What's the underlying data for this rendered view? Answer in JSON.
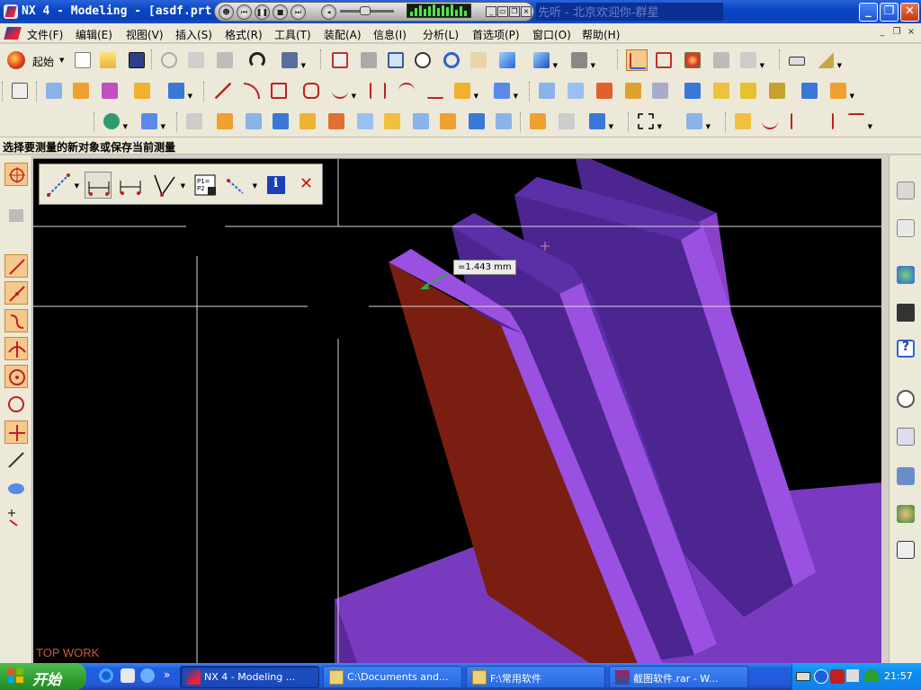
{
  "window": {
    "title": "NX 4 - Modeling - [asdf.prt",
    "lyric": "先听 - 北京欢迎你-群星",
    "buttons": {
      "minimize": "_",
      "restore": "❐",
      "close": "✕"
    }
  },
  "menubar": {
    "items": [
      "文件(F)",
      "编辑(E)",
      "视图(V)",
      "插入(S)",
      "格式(R)",
      "工具(T)",
      "装配(A)",
      "信息(I)",
      "分析(L)",
      "首选项(P)",
      "窗口(O)",
      "帮助(H)"
    ],
    "mdi": [
      "_",
      "❐",
      "×"
    ]
  },
  "toolbar": {
    "start_label": "起始"
  },
  "prompt": "选择要测量的新对象或保存当前测量",
  "viewport": {
    "view_name": "TOP WORK",
    "measurement": "=1.443 mm"
  },
  "measure_toolbar": {
    "tools": [
      "measure-distance",
      "measure-length-projected",
      "measure-length-screen",
      "measure-angle",
      "save-measurement",
      "measure-options",
      "information",
      "close"
    ],
    "info_glyph": "i",
    "close_glyph": "✕",
    "save_label": "P1=\nP2"
  },
  "taskbar": {
    "start_label": "开始",
    "overflow": "»",
    "tasks": [
      {
        "label": "NX 4 - Modeling ...",
        "active": true
      },
      {
        "label": "C:\\Documents and...",
        "active": false
      },
      {
        "label": "F:\\常用软件",
        "active": false
      },
      {
        "label": "截图软件.rar - W...",
        "active": false
      }
    ],
    "clock": "21:57"
  },
  "colors": {
    "accent_orange": "#f6c88c",
    "model_purple": "#8b40c8",
    "model_dark_purple": "#4c2590",
    "selected_face": "#7a1e12",
    "viewport_bg": "#000000",
    "titlebar_blue": "#0a46c8"
  }
}
